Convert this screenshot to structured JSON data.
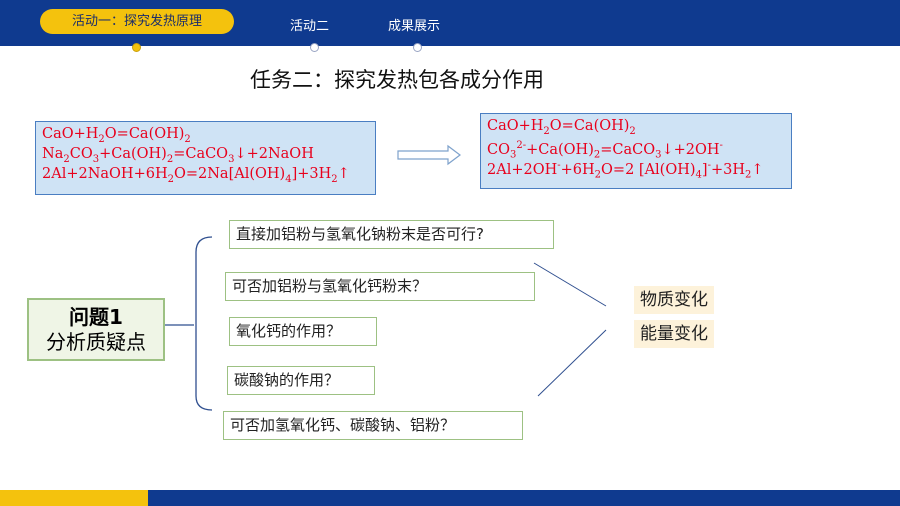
{
  "nav": {
    "items": [
      {
        "label": "活动一：探究发热原理",
        "active": true
      },
      {
        "label": "活动二",
        "active": false
      },
      {
        "label": "成果展示",
        "active": false
      }
    ]
  },
  "title": "任务二：探究发热包各成分作用",
  "left_equations": {
    "line1": {
      "a": "CaO+H",
      "a_sub": "2",
      "b": "O=Ca(OH)",
      "b_sub": "2"
    },
    "line2": {
      "a": "Na",
      "a_sub": "2",
      "b": "CO",
      "b_sub": "3",
      "c": "+Ca(OH)",
      "c_sub": "2",
      "d": "=CaCO",
      "d_sub": "3",
      "e": "↓+2NaOH"
    },
    "line3": {
      "a": "2Al+2NaOH+6H",
      "a_sub": "2",
      "b": "O=2Na[Al(OH)",
      "b_sub": "4",
      "c": "]+3H",
      "c_sub": "2",
      "d": "↑"
    }
  },
  "right_equations": {
    "line1": {
      "a": "CaO+H",
      "a_sub": "2",
      "b": "O=Ca(OH)",
      "b_sub": "2"
    },
    "line2": {
      "a": "CO",
      "a_sub": "3",
      "a_sup": "2-",
      "b": "+Ca(OH)",
      "b_sub": "2",
      "c": "=CaCO",
      "c_sub": "3",
      "d": "↓+2OH",
      "d_sup": "-"
    },
    "line3": {
      "a": "2Al+2OH",
      "a_sup": "-",
      "b": "+6H",
      "b_sub": "2",
      "c": "O=2 [Al(OH)",
      "c_sub": "4",
      "d": "]",
      "d_sup": "-",
      "e": "+3H",
      "e_sub": "2",
      "f": "↑"
    }
  },
  "problem": {
    "line1": "问题1",
    "line2": "分析质疑点"
  },
  "questions": [
    "直接加铝粉与氢氧化钠粉末是否可行?",
    "可否加铝粉与氢氧化钙粉末？",
    "氧化钙的作用？",
    "碳酸钠的作用？",
    "可否加氢氧化钙、碳酸钠、铝粉？"
  ],
  "tags": [
    "物质变化",
    "能量变化"
  ],
  "colors": {
    "bar_blue": "#0f3a8f",
    "bar_yellow": "#f4c20d",
    "equation_red": "#e8001c",
    "box_green": "#9dc183"
  }
}
